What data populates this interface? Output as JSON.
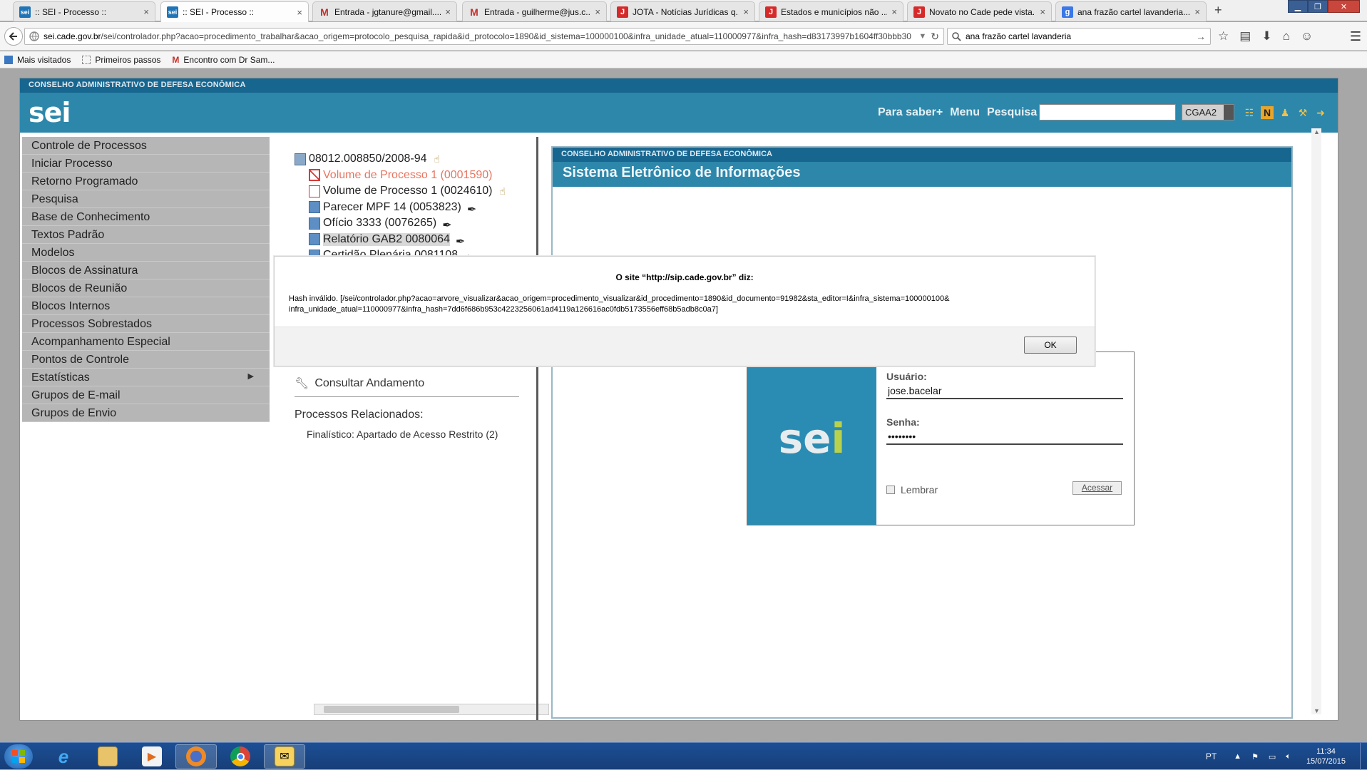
{
  "browser": {
    "tabs": [
      {
        "label": ":: SEI - Processo ::",
        "icon": "sei"
      },
      {
        "label": ":: SEI - Processo ::",
        "icon": "sei",
        "active": true
      },
      {
        "label": "Entrada - jgtanure@gmail....",
        "icon": "gmail"
      },
      {
        "label": "Entrada - guilherme@jus.c...",
        "icon": "gmail"
      },
      {
        "label": "JOTA - Notícias Jurídicas q...",
        "icon": "jota"
      },
      {
        "label": "Estados e municípios não ...",
        "icon": "jota"
      },
      {
        "label": "Novato no Cade pede vista...",
        "icon": "jota"
      },
      {
        "label": "ana frazão cartel lavanderia...",
        "icon": "google"
      }
    ],
    "url_host": "sei.cade.gov.br",
    "url_path": "/sei/controlador.php?acao=procedimento_trabalhar&acao_origem=protocolo_pesquisa_rapida&id_protocolo=1890&id_sistema=100000100&infra_unidade_atual=110000977&infra_hash=d83173997b1604ff30bbb30",
    "search_value": "ana frazão cartel lavanderia",
    "bookmarks": [
      "Mais visitados",
      "Primeiros passos",
      "Encontro com Dr Sam..."
    ]
  },
  "sei": {
    "org": "CONSELHO ADMINISTRATIVO DE DEFESA ECONÔMICA",
    "logo": "sei",
    "header_links": [
      "Para saber+",
      "Menu",
      "Pesquisa"
    ],
    "unit_select": "CGAA2",
    "menu": [
      "Controle de Processos",
      "Iniciar Processo",
      "Retorno Programado",
      "Pesquisa",
      "Base de Conhecimento",
      "Textos Padrão",
      "Modelos",
      "Blocos de Assinatura",
      "Blocos de Reunião",
      "Blocos Internos",
      "Processos Sobrestados",
      "Acompanhamento Especial",
      "Pontos de Controle",
      "Estatísticas",
      "Grupos de E-mail",
      "Grupos de Envio"
    ],
    "tree": {
      "process_number": "08012.008850/2008-94",
      "items": [
        {
          "label": "Volume de Processo 1 (0001590)",
          "type": "cancelled"
        },
        {
          "label": "Volume de Processo 1 (0024610)",
          "type": "pdf"
        },
        {
          "label": "Parecer MPF 14 (0053823)",
          "type": "doc"
        },
        {
          "label": "Ofício 3333 (0076265)",
          "type": "doc"
        },
        {
          "label": "Relatório GAB2 0080064",
          "type": "doc"
        },
        {
          "label": "Certidão Plenária 0081108",
          "type": "doc"
        }
      ],
      "consultar": "Consultar Andamento",
      "related_heading": "Processos Relacionados:",
      "related_item": "Finalístico: Apartado de Acesso Restrito (2)"
    },
    "login": {
      "org": "CONSELHO ADMINISTRATIVO DE DEFESA ECONÔMICA",
      "title": "Sistema Eletrônico de Informações",
      "user_label": "Usuário:",
      "user_value": "jose.bacelar",
      "pass_label": "Senha:",
      "pass_value": "••••••••",
      "remember": "Lembrar",
      "submit": "Acessar"
    }
  },
  "alert": {
    "title": "O site “http://sip.cade.gov.br” diz:",
    "message_line1": "Hash inválido. [/sei/controlador.php?acao=arvore_visualizar&acao_origem=procedimento_visualizar&id_procedimento=1890&id_documento=91982&sta_editor=I&infra_sistema=100000100&",
    "message_line2": "infra_unidade_atual=110000977&infra_hash=7dd6f686b953c4223256061ad4119a126616ac0fdb5173556eff68b5adb8c0a7]",
    "ok": "OK"
  },
  "taskbar": {
    "lang": "PT",
    "time": "11:34",
    "date": "15/07/2015"
  },
  "colors": {
    "sei_dark": "#176690",
    "sei_blue": "#2d87ab",
    "menu_gray": "#b6b6b6",
    "taskbar": "#1c4f95"
  }
}
